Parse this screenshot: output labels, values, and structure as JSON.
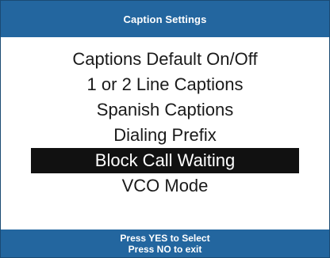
{
  "header": {
    "title": "Caption Settings"
  },
  "menu": {
    "items": [
      {
        "label": "Captions Default On/Off"
      },
      {
        "label": "1 or 2 Line Captions"
      },
      {
        "label": "Spanish Captions"
      },
      {
        "label": "Dialing Prefix"
      },
      {
        "label": "Block Call Waiting",
        "selected": true
      },
      {
        "label": "VCO Mode"
      }
    ]
  },
  "footer": {
    "line1": "Press YES to Select",
    "line2": "Press NO to exit"
  },
  "colors": {
    "bar": "#23669f",
    "highlight": "#111111",
    "text": "#1a1a1a"
  }
}
